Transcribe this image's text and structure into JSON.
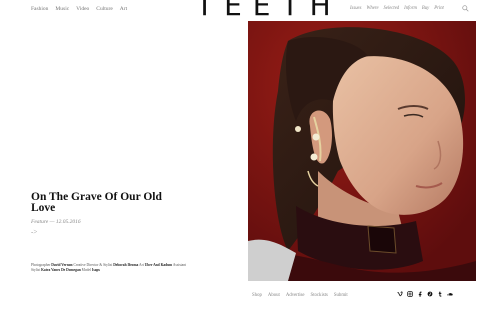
{
  "nav": {
    "items": [
      "Fashion",
      "Music",
      "Video",
      "Culture",
      "Art"
    ]
  },
  "brand": {
    "logo": "TEETH"
  },
  "subnav": {
    "items": [
      "Issues",
      "Where",
      "Selected",
      "Inform",
      "Buy",
      "Print"
    ]
  },
  "article": {
    "title": "On The Grave Of Our Old Love",
    "meta": "Feature — 12.05.2016",
    "arrow": "->",
    "credits_prefix": "Photographer",
    "credits_name1": "David Vernon",
    "credits_mid1": "Creative Director & Stylist",
    "credits_name2": "Deborah Ifeoma",
    "credits_mid2": "Art",
    "credits_line2_name": "Uber And Kadum",
    "credits_mid3": "Assistant Stylist",
    "credits_name3": "Katra Vanes De Domegan",
    "credits_mid4": "Model",
    "credits_name4": "Isaps"
  },
  "footer": {
    "links": [
      "Shop",
      "About",
      "Advertise",
      "Stockists",
      "Submit"
    ]
  },
  "social": {
    "icons": [
      "vimeo-icon",
      "instagram-icon",
      "facebook-icon",
      "pinterest-icon",
      "tumblr-icon",
      "soundcloud-icon"
    ]
  },
  "colors": {
    "photo_bg": "#7c1414",
    "accent_text": "#222222"
  }
}
